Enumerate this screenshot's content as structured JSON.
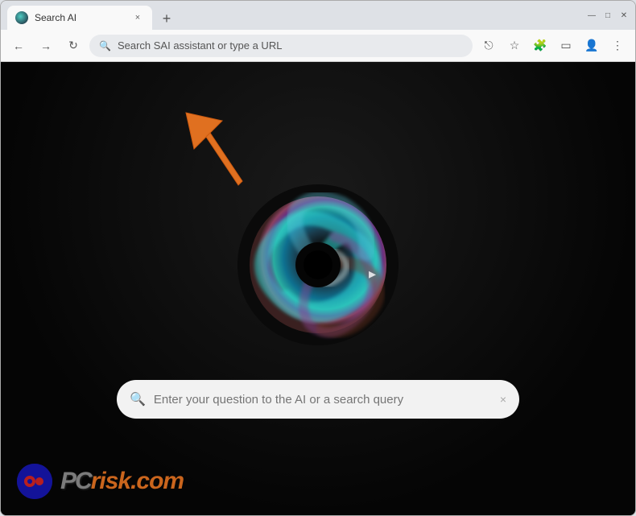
{
  "browser": {
    "tab": {
      "title": "Search AI",
      "close_label": "×"
    },
    "new_tab_label": "+",
    "window_controls": {
      "minimize": "—",
      "maximize": "□",
      "close": "✕"
    },
    "nav": {
      "back_label": "←",
      "forward_label": "→",
      "reload_label": "↻",
      "address_placeholder": "Search SAI assistant or type a URL"
    },
    "nav_actions": {
      "share_label": "⎋",
      "bookmark_label": "☆",
      "extensions_label": "🧩",
      "sidebar_label": "▭",
      "profile_label": "👤",
      "menu_label": "⋮"
    }
  },
  "page": {
    "search_placeholder": "Enter your question to the AI or a search query",
    "search_clear_label": "×"
  },
  "watermark": {
    "text_gray": "PC",
    "text_orange": "risk.com"
  },
  "colors": {
    "accent_orange": "#e07020",
    "page_bg": "#0a0a0a",
    "browser_chrome": "#dee1e6"
  }
}
